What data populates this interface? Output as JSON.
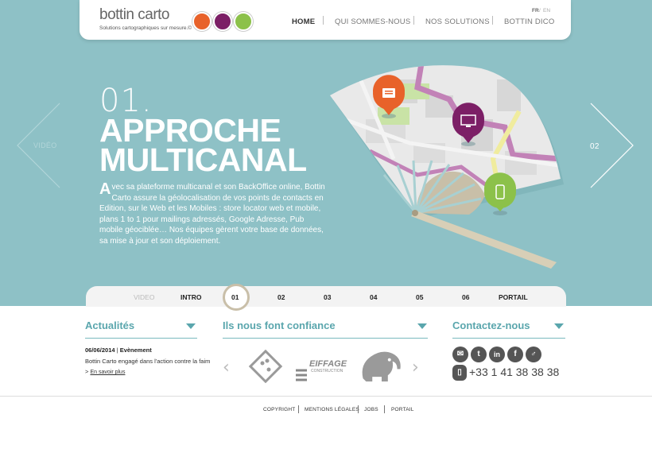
{
  "brand": {
    "name": "bottin carto",
    "tagline": "Solutions cartographiques sur mesure.©"
  },
  "nav": {
    "items": [
      "HOME",
      "QUI SOMMES-NOUS",
      "NOS SOLUTIONS",
      "BOTTIN DICO"
    ],
    "lang_fr": "FR",
    "lang_sep": "/",
    "lang_en": "EN"
  },
  "hero": {
    "left_label": "VIDÉO",
    "right_label": "02",
    "number": "01.",
    "title_line1": "APPROCHE",
    "title_line2": "MULTICANAL",
    "desc_initial": "A",
    "desc": "vec sa plateforme multicanal et son BackOffice online, Bottin Carto assure la géolocalisation de vos points de contacts en Edition, sur le Web et les Mobiles : store locator web et mobile, plans 1 to 1 pour mailings adressés, Google Adresse, Pub mobile géociblée… Nos équipes gèrent votre base de données, sa mise à jour et son déploiement."
  },
  "timeline": [
    "VIDEO",
    "INTRO",
    "01",
    "02",
    "03",
    "04",
    "05",
    "06",
    "PORTAIL"
  ],
  "news": {
    "heading": "Actualités",
    "date": "06/06/2014",
    "sep": "|",
    "type": "Evènement",
    "text": "Bottin Carto engagé dans l'action contre la faim",
    "more": "En savoir plus",
    "more_prefix": ">"
  },
  "trust": {
    "heading": "Ils nous font confiance",
    "prev": "‹",
    "next": "›",
    "logo_2_line1": "EIFFAGE",
    "logo_2_line2": "CONSTRUCTION"
  },
  "contact": {
    "heading": "Contactez-nous",
    "phone": "+33 1 41 38 38 38"
  },
  "footer": [
    "COPYRIGHT",
    "MENTIONS LÉGALES",
    "JOBS",
    "PORTAIL"
  ],
  "colors": {
    "teal": "#8ec1c6",
    "orange": "#e8622a",
    "purple": "#7c1f66",
    "green": "#8cc14a",
    "heading": "#5aa6ad"
  }
}
